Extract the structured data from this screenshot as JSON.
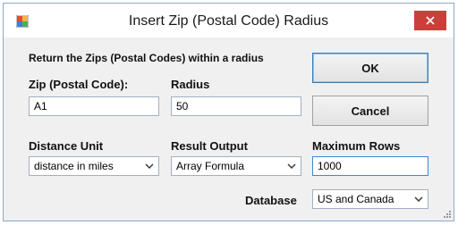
{
  "window": {
    "title": "Insert Zip (Postal Code) Radius"
  },
  "form": {
    "heading": "Return the Zips (Postal Codes) within a radius",
    "zip": {
      "label": "Zip (Postal Code):",
      "value": "A1"
    },
    "radius": {
      "label": "Radius",
      "value": "50"
    },
    "distance_unit": {
      "label": "Distance Unit",
      "selected": "distance in miles"
    },
    "result_output": {
      "label": "Result Output",
      "selected": "Array Formula"
    },
    "max_rows": {
      "label": "Maximum Rows",
      "value": "1000"
    },
    "database": {
      "label": "Database",
      "selected": "US and Canada"
    }
  },
  "buttons": {
    "ok": "OK",
    "cancel": "Cancel"
  },
  "colors": {
    "close_bg": "#c9403a",
    "focus_border": "#3a88d6",
    "window_border": "#8fa8c8"
  }
}
